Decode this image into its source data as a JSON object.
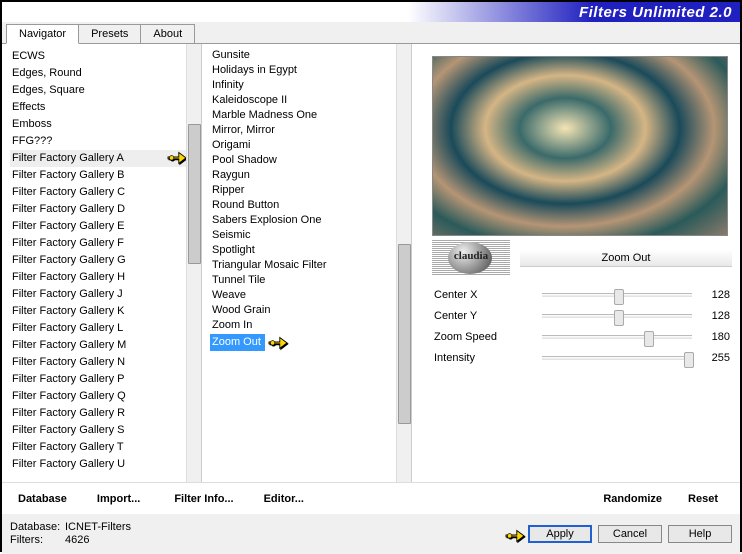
{
  "title": "Filters Unlimited 2.0",
  "tabs": [
    {
      "label": "Navigator",
      "active": true
    },
    {
      "label": "Presets",
      "active": false
    },
    {
      "label": "About",
      "active": false
    }
  ],
  "categories": [
    "ECWS",
    "Edges, Round",
    "Edges, Square",
    "Effects",
    "Emboss",
    "FFG???",
    "Filter Factory Gallery A",
    "Filter Factory Gallery B",
    "Filter Factory Gallery C",
    "Filter Factory Gallery D",
    "Filter Factory Gallery E",
    "Filter Factory Gallery F",
    "Filter Factory Gallery G",
    "Filter Factory Gallery H",
    "Filter Factory Gallery J",
    "Filter Factory Gallery K",
    "Filter Factory Gallery L",
    "Filter Factory Gallery M",
    "Filter Factory Gallery N",
    "Filter Factory Gallery P",
    "Filter Factory Gallery Q",
    "Filter Factory Gallery R",
    "Filter Factory Gallery S",
    "Filter Factory Gallery T",
    "Filter Factory Gallery U"
  ],
  "pointed_category_index": 6,
  "filters": [
    "Gunsite",
    "Holidays in Egypt",
    "Infinity",
    "Kaleidoscope II",
    "Marble Madness One",
    "Mirror, Mirror",
    "Origami",
    "Pool Shadow",
    "Raygun",
    "Ripper",
    "Round Button",
    "Sabers Explosion One",
    "Seismic",
    "Spotlight",
    "Triangular Mosaic Filter",
    "Tunnel Tile",
    "Weave",
    "Wood Grain",
    "Zoom In",
    "Zoom Out"
  ],
  "selected_filter_index": 19,
  "current_filter": "Zoom Out",
  "watermark": "claudia",
  "params": [
    {
      "label": "Center X",
      "value": 128,
      "pos": "pos128"
    },
    {
      "label": "Center Y",
      "value": 128,
      "pos": "pos128"
    },
    {
      "label": "Zoom Speed",
      "value": 180,
      "pos": "pos180"
    },
    {
      "label": "Intensity",
      "value": 255,
      "pos": "pos255"
    }
  ],
  "link_buttons": {
    "database": "Database",
    "import": "Import...",
    "filter_info": "Filter Info...",
    "editor": "Editor...",
    "randomize": "Randomize",
    "reset": "Reset"
  },
  "status": {
    "db_label": "Database:",
    "db_value": "ICNET-Filters",
    "filters_label": "Filters:",
    "filters_value": "4626"
  },
  "buttons": {
    "apply": "Apply",
    "cancel": "Cancel",
    "help": "Help"
  }
}
